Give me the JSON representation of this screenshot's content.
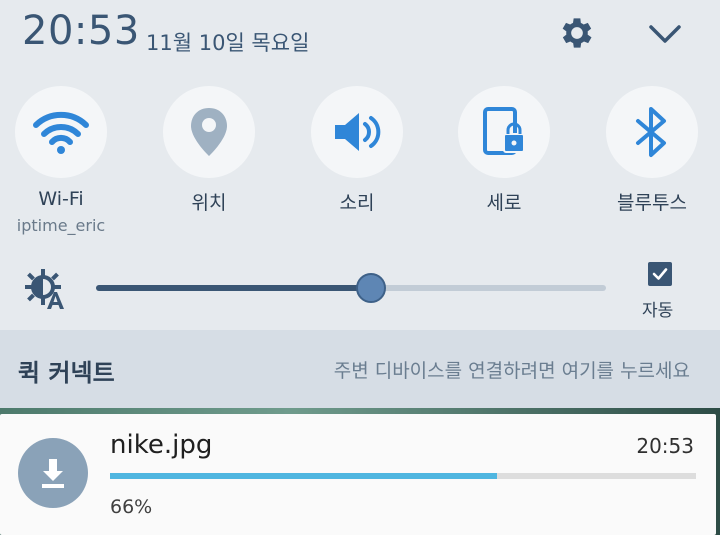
{
  "status": {
    "time": "20:53",
    "date": "11월 10일 목요일"
  },
  "icons": {
    "settings": "gear-icon",
    "expand": "chevron-down-icon"
  },
  "tiles": [
    {
      "label": "Wi-Fi",
      "sub": "iptime_eric",
      "icon": "wifi-icon",
      "active": true
    },
    {
      "label": "위치",
      "sub": "",
      "icon": "location-icon",
      "active": false
    },
    {
      "label": "소리",
      "sub": "",
      "icon": "sound-icon",
      "active": true
    },
    {
      "label": "세로",
      "sub": "",
      "icon": "portrait-lock-icon",
      "active": true
    },
    {
      "label": "블루투스",
      "sub": "",
      "icon": "bluetooth-icon",
      "active": true
    }
  ],
  "brightness": {
    "level": 0.54,
    "auto_label": "자동",
    "auto_checked": true
  },
  "quick_connect": {
    "title": "퀵 커넥트",
    "hint": "주변 디바이스를 연결하려면 여기를 누르세요"
  },
  "notification": {
    "file_name": "nike.jpg",
    "time": "20:53",
    "progress": 0.66,
    "percent": "66%"
  },
  "colors": {
    "accent": "#2f86d8",
    "inactive": "#9fb1c2",
    "progress": "#4fb6e0",
    "brand_text": "#3a5674"
  }
}
